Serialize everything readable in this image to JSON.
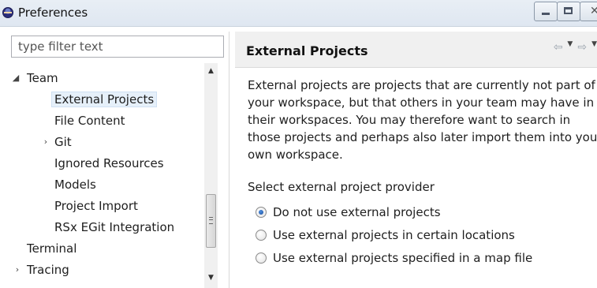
{
  "window": {
    "title": "Preferences"
  },
  "filter": {
    "placeholder": "type filter text"
  },
  "tree": {
    "items": [
      {
        "label": "Team",
        "twisty": "expanded"
      },
      {
        "label": "External Projects",
        "twisty": "none",
        "selected": true
      },
      {
        "label": "File Content",
        "twisty": "none"
      },
      {
        "label": "Git",
        "twisty": "collapsed"
      },
      {
        "label": "Ignored Resources",
        "twisty": "none"
      },
      {
        "label": "Models",
        "twisty": "none"
      },
      {
        "label": "Project Import",
        "twisty": "none"
      },
      {
        "label": "RSx EGit Integration",
        "twisty": "none"
      },
      {
        "label": "Terminal",
        "twisty": "none"
      },
      {
        "label": "Tracing",
        "twisty": "collapsed"
      }
    ]
  },
  "page": {
    "title": "External Projects",
    "description": "External projects are projects that are currently not part of your workspace, but that others in your team may have in their workspaces. You may therefore want to search in those projects and perhaps also later import them into your own workspace.",
    "group_label": "Select external project provider",
    "options": [
      {
        "label": "Do not use external projects",
        "checked": true
      },
      {
        "label": "Use external projects in certain locations",
        "checked": false
      },
      {
        "label": "Use external projects specified in a map file",
        "checked": false
      }
    ]
  },
  "icons": {
    "app": "eclipse-icon",
    "minimize": "minimize-icon",
    "maximize": "maximize-icon",
    "back": "back-arrow-icon",
    "forward": "forward-arrow-icon",
    "dropdown": "chevron-down-icon"
  }
}
